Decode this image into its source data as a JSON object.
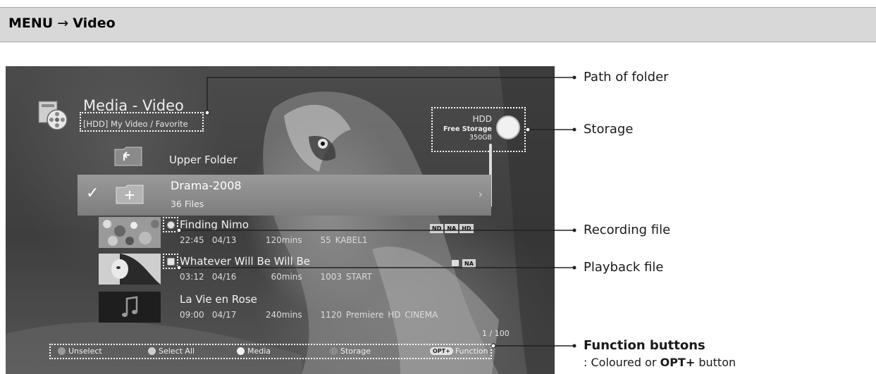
{
  "header": {
    "menu": "MENU",
    "arrow": "→",
    "section": "Video"
  },
  "screen": {
    "title": "Media - Video",
    "path": "[HDD] My Video / Favorite",
    "storage": {
      "device": "HDD",
      "free_label": "Free Storage",
      "free_value": "350GB"
    },
    "upper_folder": "Upper Folder",
    "selected_folder": {
      "name": "Drama-2008",
      "sub": "36 Files",
      "check": "✓",
      "arrow": "›"
    },
    "files": [
      {
        "name": "Finding Nimo",
        "time": "22:45",
        "date": "04/13",
        "duration": "120mins",
        "channel": "55 KABEL1",
        "badges": [
          "ND",
          "NA",
          "HD"
        ]
      },
      {
        "name": "Whatever Will Be Will Be",
        "time": "03:12",
        "date": "04/16",
        "duration": "60mins",
        "channel": "1003 START",
        "badges": [
          "NA"
        ]
      },
      {
        "name": "La Vie en Rose",
        "time": "09:00",
        "date": "04/17",
        "duration": "240mins",
        "channel": "1120 Premiere HD CINEMA",
        "badges": []
      }
    ],
    "counter": "1 / 100",
    "function_buttons": [
      {
        "label": "Unselect",
        "color": "#9a9a9a"
      },
      {
        "label": "Select All",
        "color": "#cfcfcf"
      },
      {
        "label": "Media",
        "color": "#f2f2f2"
      },
      {
        "label": "Storage",
        "color": "#8c8c8c"
      },
      {
        "label": "Function",
        "key": "OPT+"
      }
    ]
  },
  "callouts": {
    "path_of_folder": "Path of folder",
    "storage": "Storage",
    "recording_file": "Recording file",
    "playback_file": "Playback file",
    "function_buttons": "Function buttons",
    "function_sub_prefix": ": Coloured or",
    "function_sub_key": "OPT+",
    "function_sub_suffix": "button"
  }
}
